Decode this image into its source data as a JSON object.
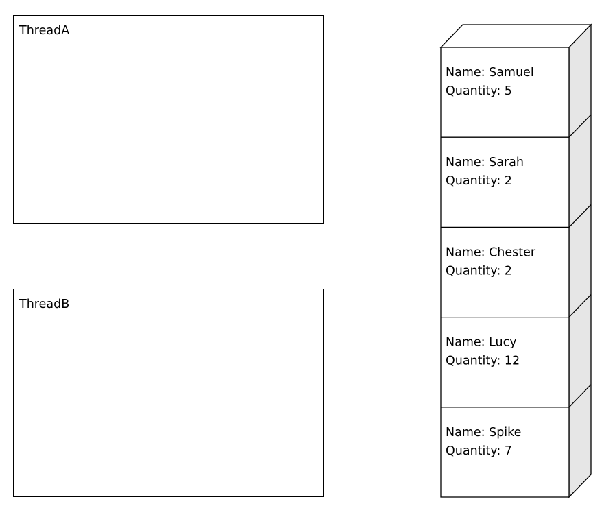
{
  "threads": [
    {
      "label": "ThreadA"
    },
    {
      "label": "ThreadB"
    }
  ],
  "stack": {
    "name_prefix": "Name: ",
    "quantity_prefix": "Quantity: ",
    "records": [
      {
        "name": "Samuel",
        "quantity": 5
      },
      {
        "name": "Sarah",
        "quantity": 2
      },
      {
        "name": "Chester",
        "quantity": 2
      },
      {
        "name": "Lucy",
        "quantity": 12
      },
      {
        "name": "Spike",
        "quantity": 7
      }
    ],
    "colors": {
      "stroke": "#000000",
      "face": "#ffffff",
      "side": "#e6e6e6"
    }
  }
}
